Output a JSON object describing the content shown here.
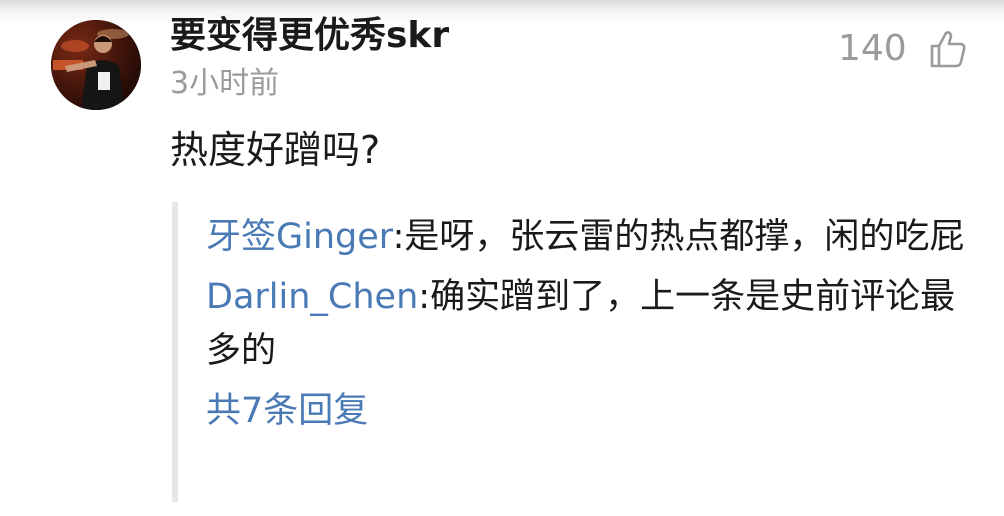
{
  "comment": {
    "username": "要变得更优秀skr",
    "time": "3小时前",
    "likes": "140",
    "like_icon": "thumbs-up-icon",
    "text": "热度好蹭吗?"
  },
  "replies": [
    {
      "author": "牙签Ginger",
      "separator": ":",
      "text": "是呀，张云雷的热点都撑，闲的吃屁"
    },
    {
      "author": "Darlin_Chen",
      "separator": ":",
      "text": "确实蹭到了，上一条是史前评论最多的"
    }
  ],
  "more_replies_label": "共7条回复",
  "colors": {
    "link": "#4a7ab5",
    "muted": "#9b9b9b",
    "text": "#1a1a1a"
  }
}
